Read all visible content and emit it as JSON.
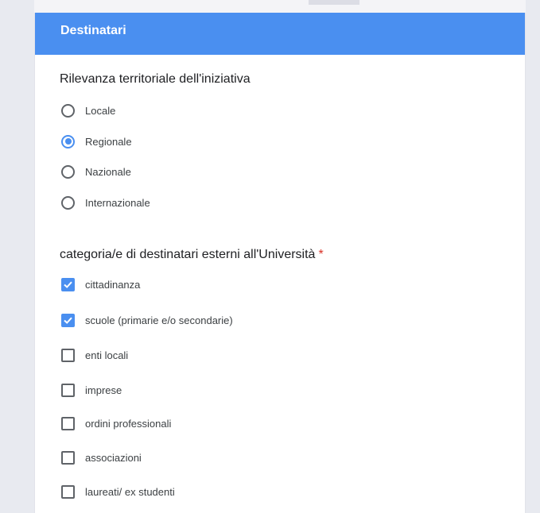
{
  "section": {
    "title": "Destinatari"
  },
  "question1": {
    "title": "Rilevanza territoriale dell'iniziativa",
    "options": [
      {
        "label": "Locale",
        "checked": false
      },
      {
        "label": "Regionale",
        "checked": true
      },
      {
        "label": "Nazionale",
        "checked": false
      },
      {
        "label": "Internazionale",
        "checked": false
      }
    ]
  },
  "question2": {
    "title": "categoria/e di destinatari esterni all'Università",
    "required_mark": "*",
    "options": [
      {
        "label": "cittadinanza",
        "checked": true
      },
      {
        "label": "scuole (primarie e/o secondarie)",
        "checked": true
      },
      {
        "label": "enti locali",
        "checked": false
      },
      {
        "label": "imprese",
        "checked": false
      },
      {
        "label": "ordini professionali",
        "checked": false
      },
      {
        "label": "associazioni",
        "checked": false
      },
      {
        "label": "laureati/ ex studenti",
        "checked": false
      }
    ]
  },
  "colors": {
    "accent": "#4a8ff0",
    "required": "#d93025"
  }
}
